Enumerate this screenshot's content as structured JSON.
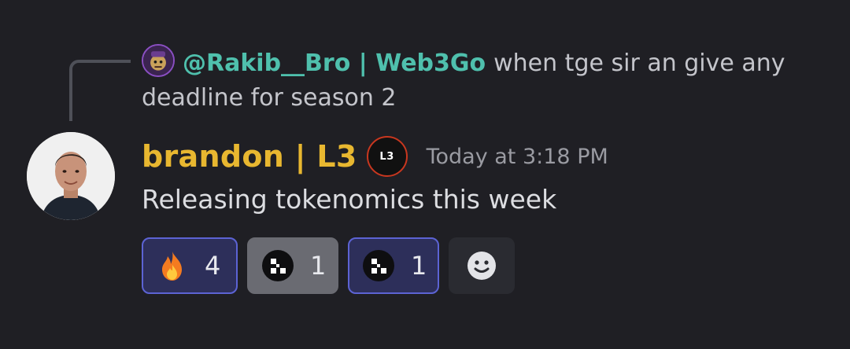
{
  "reply": {
    "mention": "@Rakib__Bro | Web3Go",
    "text": "when tge sir an give any deadline for season 2"
  },
  "message": {
    "username": "brandon | L3",
    "role_badge": "L3",
    "timestamp": "Today at 3:18 PM",
    "body": "Releasing tokenomics this week"
  },
  "reactions": [
    {
      "emoji": "fire-emoji",
      "count": "4",
      "active": true
    },
    {
      "emoji": "l3-logo-emoji",
      "count": "1",
      "active": false
    },
    {
      "emoji": "l3-logo-emoji",
      "count": "1",
      "active": true
    }
  ],
  "colors": {
    "background": "#1f1f24",
    "username": "#e8b730",
    "mention": "#4fc0ad",
    "active_reaction_border": "#5c63d4",
    "active_reaction_bg": "#2d2f5a",
    "neutral_reaction_bg": "#6a6b72"
  }
}
